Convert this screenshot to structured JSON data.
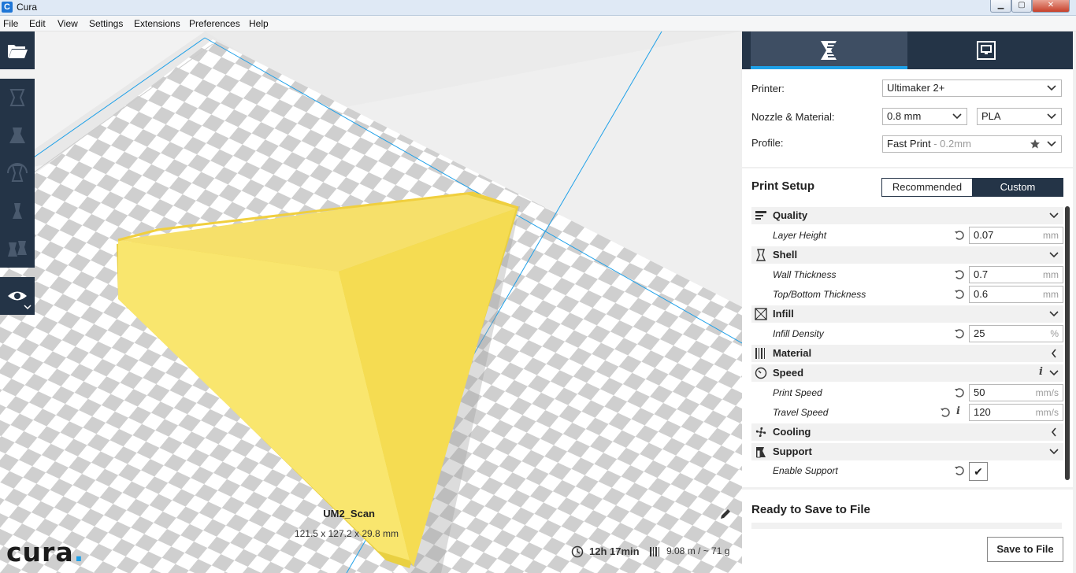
{
  "window": {
    "title": "Cura",
    "app_icon_letter": "C",
    "controls": {
      "minimize": "▁",
      "maximize": "▢",
      "close": "✕"
    }
  },
  "menu": [
    "File",
    "Edit",
    "View",
    "Settings",
    "Extensions",
    "Preferences",
    "Help"
  ],
  "left_toolbar": {
    "icons": [
      "open-file-icon",
      "translate-tool-icon",
      "scale-tool-icon",
      "rotate-tool-icon",
      "mirror-tool-icon",
      "per-model-settings-icon",
      "view-mode-icon"
    ]
  },
  "logo": {
    "text": "cura",
    "dot": "."
  },
  "job": {
    "name": "UM2_Scan",
    "dimensions": "121.5 x 127.2 x 29.8 mm",
    "print_time": "12h 17min",
    "material_usage": "9.08 m / ~ 71 g"
  },
  "panel": {
    "tabs": [
      "prepare-tab",
      "monitor-tab"
    ],
    "printer_label": "Printer:",
    "printer_value": "Ultimaker 2+",
    "nozzle_label": "Nozzle & Material:",
    "nozzle_value": "0.8 mm",
    "material_value": "PLA",
    "profile_label": "Profile:",
    "profile_value": "Fast Print",
    "profile_suffix": " - 0.2mm"
  },
  "print_setup": {
    "title": "Print Setup",
    "mode_recommended": "Recommended",
    "mode_custom": "Custom",
    "categories": [
      {
        "label": "Quality",
        "expanded": true
      },
      {
        "label": "Shell",
        "expanded": true
      },
      {
        "label": "Infill",
        "expanded": true
      },
      {
        "label": "Material",
        "expanded": false
      },
      {
        "label": "Speed",
        "expanded": true
      },
      {
        "label": "Cooling",
        "expanded": false
      },
      {
        "label": "Support",
        "expanded": true
      }
    ],
    "settings": [
      {
        "label": "Layer Height",
        "value": "0.07",
        "unit": "mm"
      },
      {
        "label": "Wall Thickness",
        "value": "0.7",
        "unit": "mm"
      },
      {
        "label": "Top/Bottom Thickness",
        "value": "0.6",
        "unit": "mm"
      },
      {
        "label": "Infill Density",
        "value": "25",
        "unit": "%"
      },
      {
        "label": "Print Speed",
        "value": "50",
        "unit": "mm/s"
      },
      {
        "label": "Travel Speed",
        "value": "120",
        "unit": "mm/s"
      },
      {
        "label": "Enable Support",
        "value": "✔",
        "unit": ""
      }
    ],
    "info_symbol": "i",
    "chevron_down": "⌄",
    "chevron_left": "‹"
  },
  "save": {
    "status": "Ready to Save to File",
    "button": "Save to File"
  },
  "colors": {
    "toolbar": "#243447",
    "accent": "#1ea0e8",
    "model": "#f7e56a"
  }
}
